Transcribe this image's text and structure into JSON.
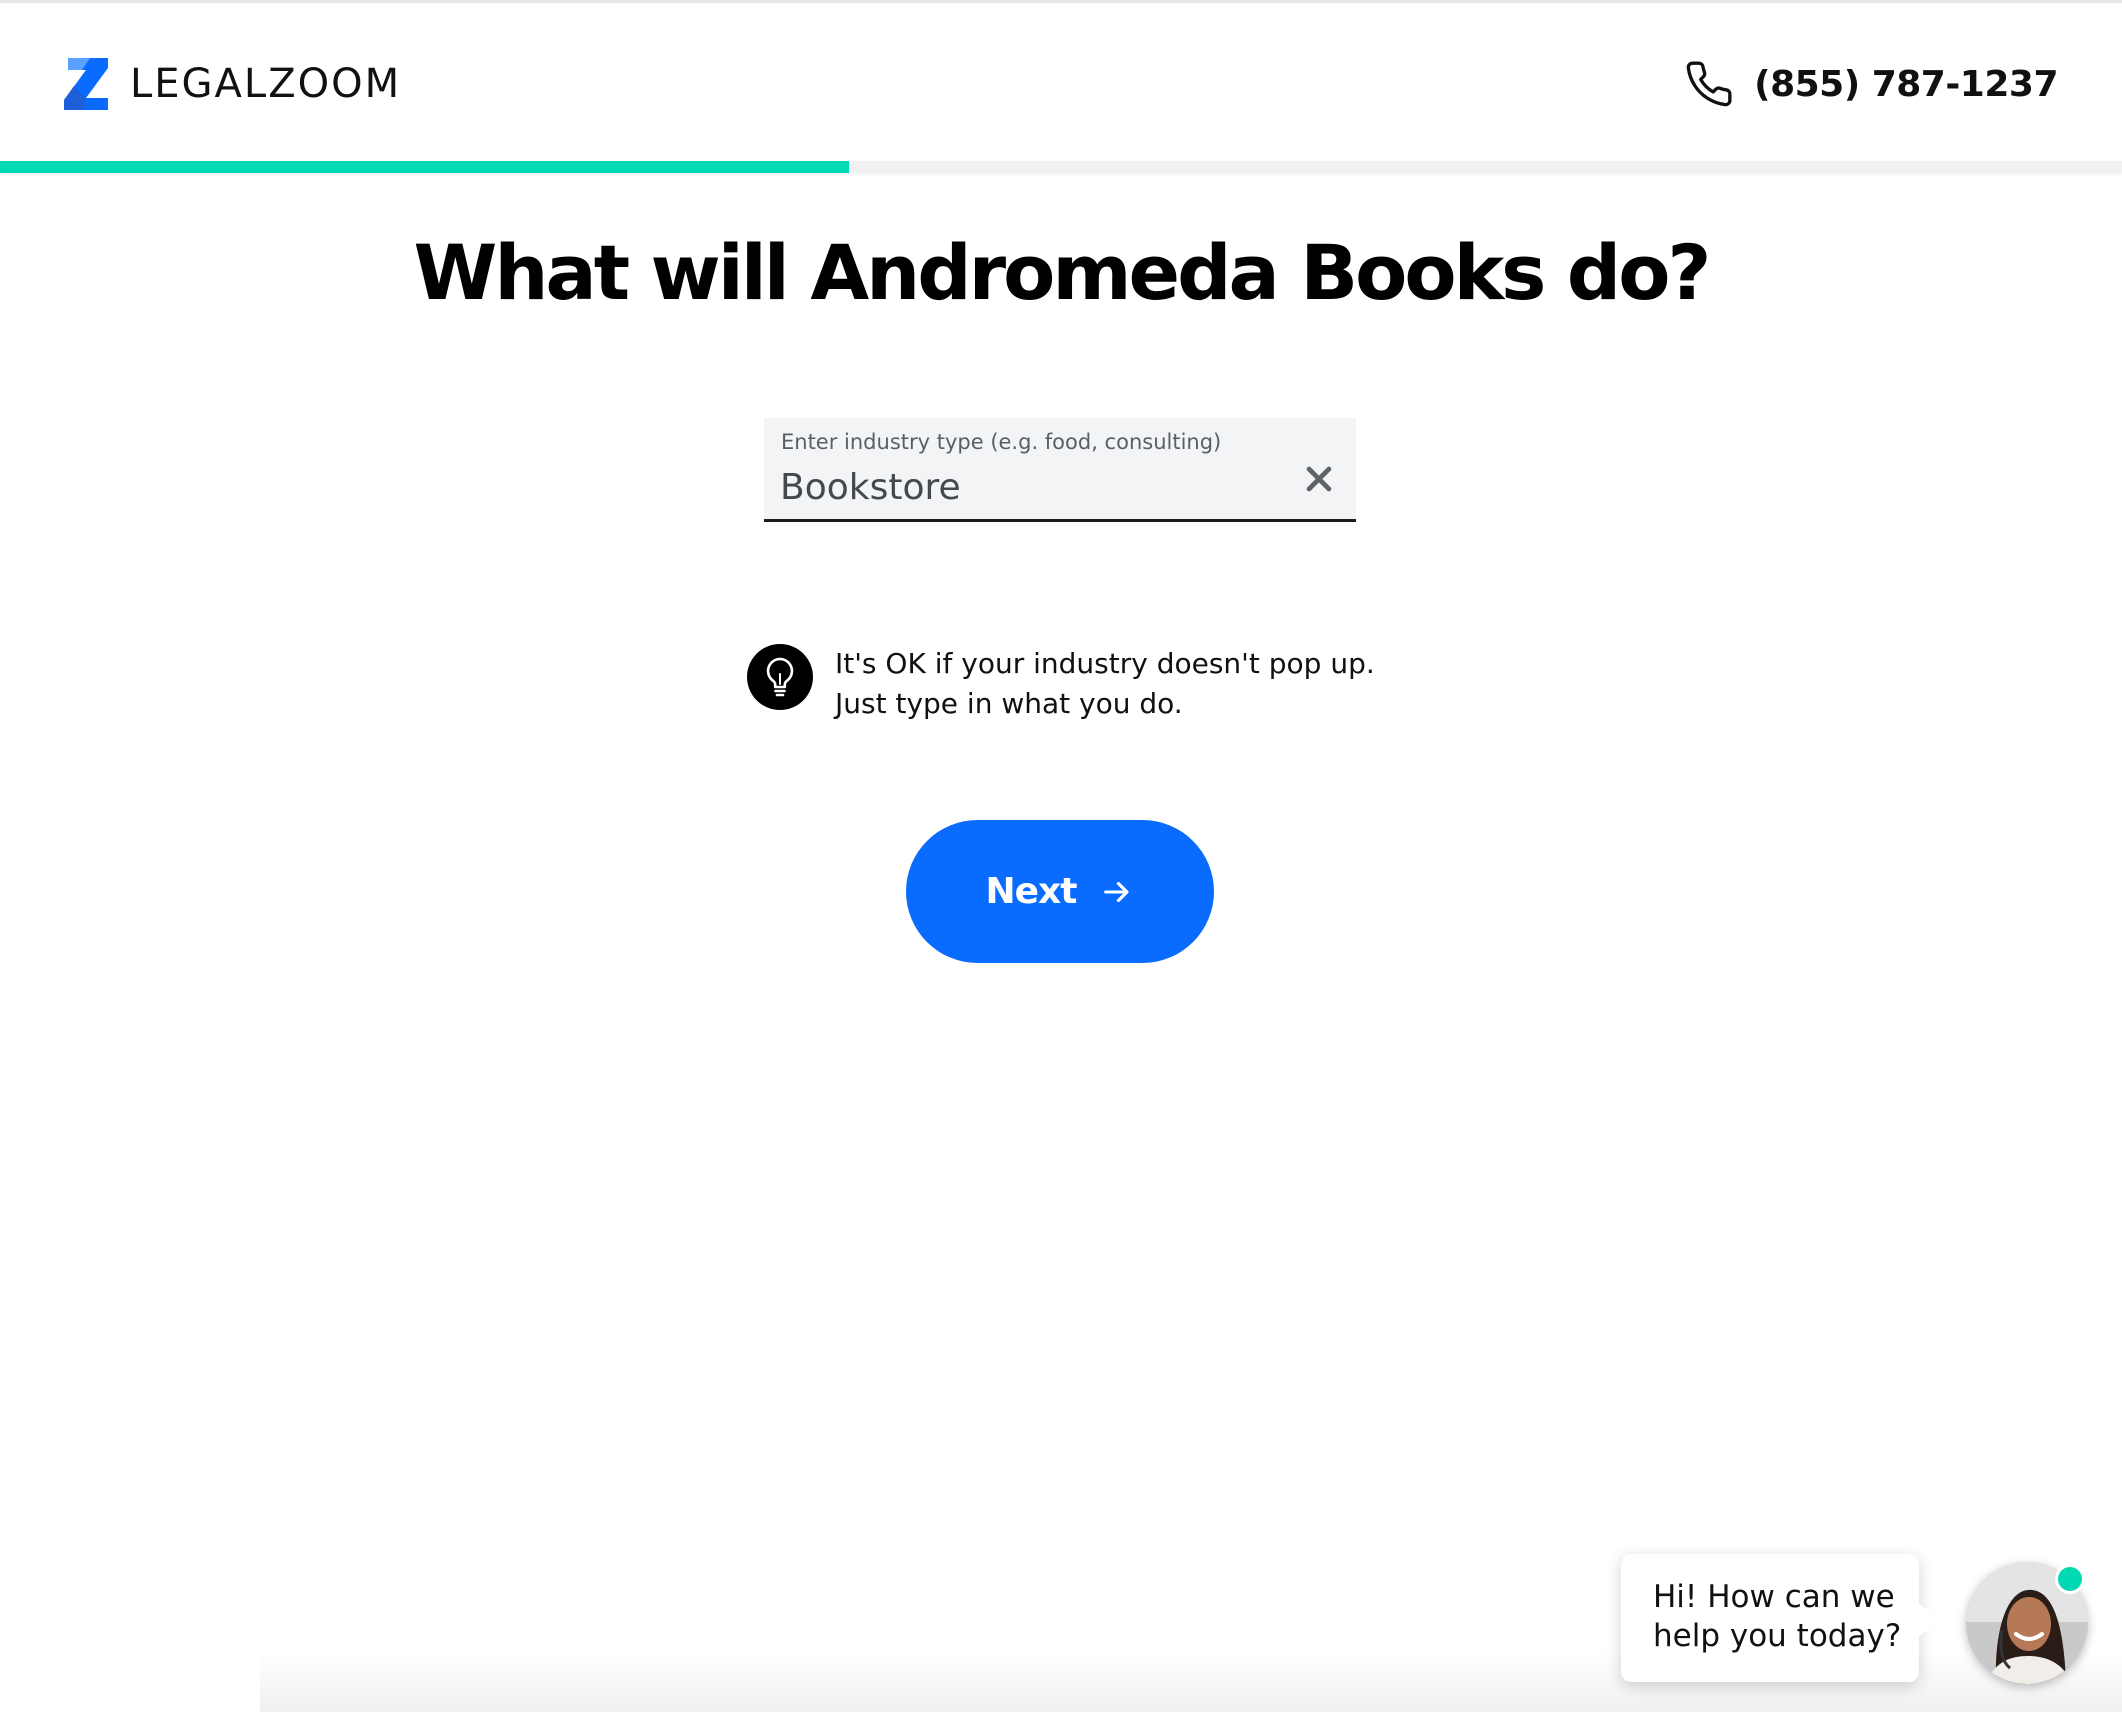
{
  "brand": {
    "name": "LEGALZOOM",
    "accent_color": "#0a6cff",
    "progress_color": "#00d9b1"
  },
  "header": {
    "phone_number": "(855) 787-1237"
  },
  "progress": {
    "fraction": 0.4
  },
  "page": {
    "title": "What will Andromeda Books do?"
  },
  "industry_field": {
    "label": "Enter industry type (e.g. food, consulting)",
    "value": "Bookstore"
  },
  "tip": {
    "line1": "It's OK if your industry doesn't pop up.",
    "line2": "Just type in what you do."
  },
  "actions": {
    "next_label": "Next"
  },
  "chat": {
    "greeting_line1": "Hi! How can we",
    "greeting_line2": "help you today?"
  },
  "icons": [
    "legalzoom-logo-icon",
    "phone-icon",
    "clear-icon",
    "lightbulb-icon",
    "arrow-right-icon",
    "agent-avatar",
    "online-status-dot"
  ]
}
